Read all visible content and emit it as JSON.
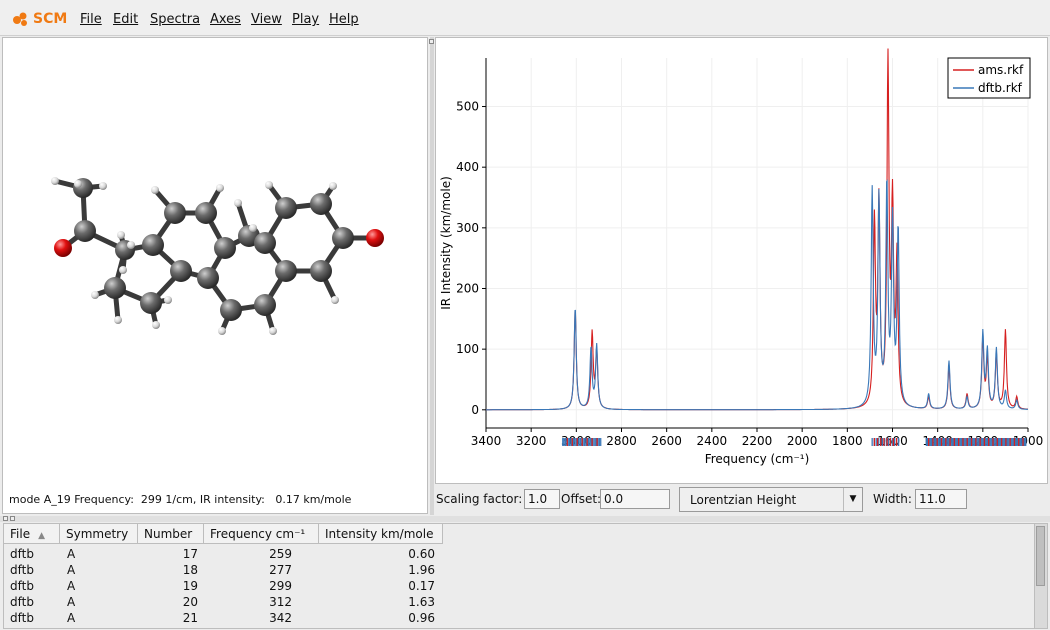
{
  "app": {
    "logo_text": "SCM"
  },
  "menu": {
    "items": [
      "File",
      "Edit",
      "Spectra",
      "Axes",
      "View",
      "Play",
      "Help"
    ]
  },
  "molecule_panel": {
    "mode_info": "mode A_19 Frequency:  299 1/cm, IR intensity:   0.17 km/mole"
  },
  "controls": {
    "scaling_label": "Scaling factor:",
    "scaling_value": "1.0",
    "offset_label": "Offset:",
    "offset_value": "0.0",
    "lineshape_value": "Lorentzian Height",
    "width_label": "Width:",
    "width_value": "11.0"
  },
  "table": {
    "columns": [
      "File",
      "Symmetry",
      "Number",
      "Frequency cm⁻¹",
      "Intensity km/mole"
    ],
    "rows": [
      [
        "dftb",
        "A",
        "17",
        "259",
        "0.60"
      ],
      [
        "dftb",
        "A",
        "18",
        "277",
        "1.96"
      ],
      [
        "dftb",
        "A",
        "19",
        "299",
        "0.17"
      ],
      [
        "dftb",
        "A",
        "20",
        "312",
        "1.63"
      ],
      [
        "dftb",
        "A",
        "21",
        "342",
        "0.96"
      ]
    ]
  },
  "colors": {
    "ams": "#d62020",
    "dftb": "#3a78b8",
    "brand": "#f07a13"
  },
  "chart_data": {
    "type": "line",
    "xlabel": "Frequency (cm⁻¹)",
    "ylabel": "IR Intensity (km/mole)",
    "xlim": [
      3400,
      1000
    ],
    "ylim": [
      -30,
      580
    ],
    "x_ticks": [
      3400,
      3200,
      3000,
      2800,
      2600,
      2400,
      2200,
      2000,
      1800,
      1600,
      1400,
      1200,
      1000
    ],
    "y_ticks": [
      0,
      100,
      200,
      300,
      400,
      500
    ],
    "legend": "top-right",
    "series": [
      {
        "name": "ams.rkf",
        "color": "#d62020",
        "peaks": [
          [
            3005,
            165
          ],
          [
            2930,
            125
          ],
          [
            2910,
            95
          ],
          [
            1680,
            300
          ],
          [
            1660,
            330
          ],
          [
            1620,
            560
          ],
          [
            1600,
            320
          ],
          [
            1580,
            240
          ],
          [
            1440,
            20
          ],
          [
            1350,
            70
          ],
          [
            1270,
            25
          ],
          [
            1200,
            115
          ],
          [
            1180,
            80
          ],
          [
            1140,
            90
          ],
          [
            1100,
            130
          ],
          [
            1050,
            20
          ]
        ]
      },
      {
        "name": "dftb.rkf",
        "color": "#3a78b8",
        "peaks": [
          [
            3005,
            168
          ],
          [
            2935,
            100
          ],
          [
            2910,
            105
          ],
          [
            1690,
            355
          ],
          [
            1660,
            340
          ],
          [
            1625,
            360
          ],
          [
            1600,
            300
          ],
          [
            1575,
            290
          ],
          [
            1440,
            25
          ],
          [
            1350,
            80
          ],
          [
            1270,
            20
          ],
          [
            1200,
            125
          ],
          [
            1180,
            95
          ],
          [
            1140,
            100
          ],
          [
            1100,
            30
          ],
          [
            1050,
            15
          ]
        ]
      }
    ]
  }
}
